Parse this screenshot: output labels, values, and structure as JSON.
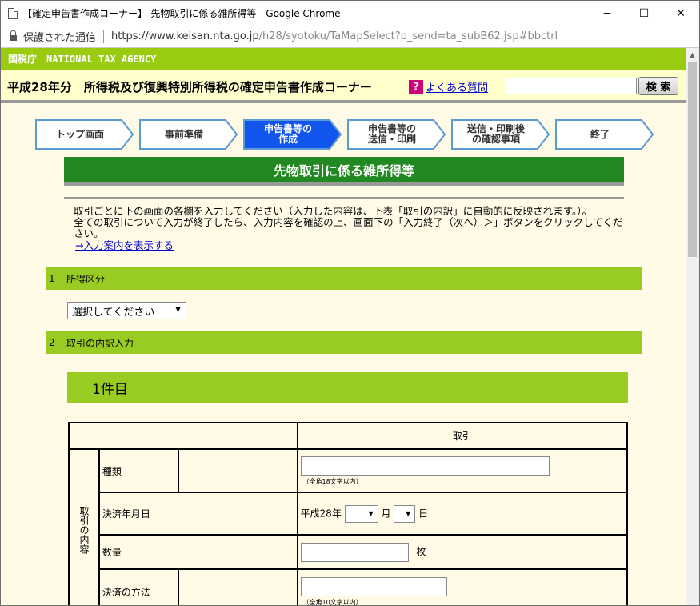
{
  "window": {
    "title": "【確定申告書作成コーナー】-先物取引に係る雑所得等 - Google Chrome",
    "minimize": "−",
    "maximize": "☐",
    "close": "✕"
  },
  "address": {
    "secure": "保護された通信",
    "url_host": "https://www.keisan.nta.go.jp",
    "url_path": "/h28/syotoku/TaMapSelect?p_send=ta_subB62.jsp#bbctrl"
  },
  "site": {
    "agency": "国税庁　NATIONAL TAX AGENCY",
    "heading": "平成28年分　所得税及び復興特別所得税の確定申告書作成コーナー",
    "faq_icon": "?",
    "faq_link": "よくある質問",
    "search_value": "",
    "search_button": "検 索"
  },
  "steps": [
    {
      "label": "トップ画面"
    },
    {
      "label": "事前準備"
    },
    {
      "label": "申告書等の\n作成",
      "active": true
    },
    {
      "label": "申告書等の\n送信・印刷"
    },
    {
      "label": "送信・印刷後\nの確認事項"
    },
    {
      "label": "終了"
    }
  ],
  "page_title": "先物取引に係る雑所得等",
  "intro": {
    "line1": "取引ごとに下の画面の各欄を入力してください（入力した内容は、下表「取引の内訳」に自動的に反映されます。）。",
    "line2": "全ての取引について入力が終了したら、入力内容を確認の上、画面下の「入力終了（次へ）＞」ボタンをクリックしてください。",
    "link": "→入力案内を表示する"
  },
  "section1": {
    "num": "1",
    "label": "所得区分"
  },
  "income_select": {
    "value": "選択してください"
  },
  "section2": {
    "num": "2",
    "label": "取引の内訳入力"
  },
  "item_header": "1件目",
  "table": {
    "col_header": "取引",
    "group_label": "取引の内容",
    "rows": {
      "kind": {
        "label": "種類",
        "hint": "（全角18文字以内）",
        "value": ""
      },
      "date": {
        "label": "決済年月日",
        "era": "平成28年",
        "month_unit": "月",
        "day_unit": "日",
        "month": "",
        "day": ""
      },
      "quantity": {
        "label": "数量",
        "unit": "枚",
        "value": ""
      },
      "method": {
        "label": "決済の方法",
        "hint": "（全角10文字以内）",
        "value": ""
      }
    }
  }
}
